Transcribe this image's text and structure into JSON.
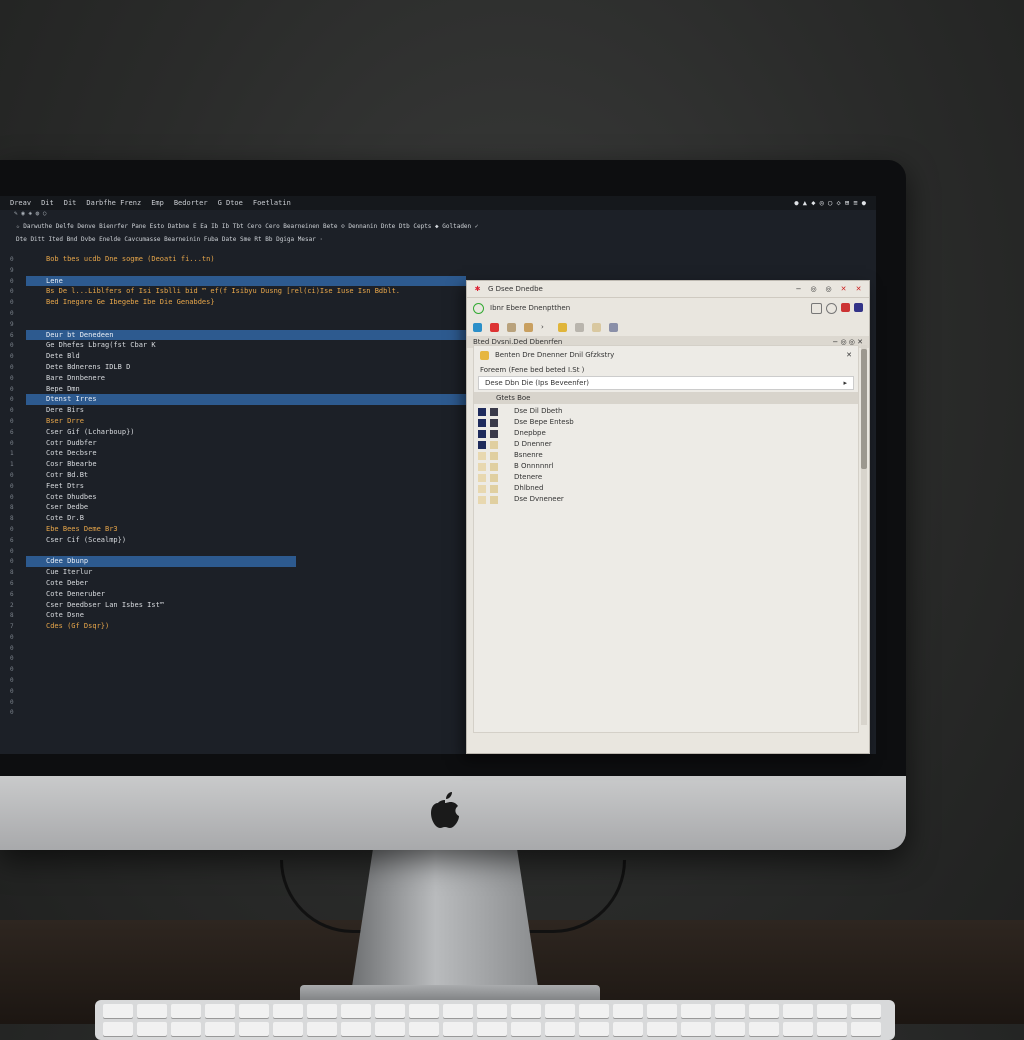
{
  "screen": {
    "menubar": {
      "items": [
        "Dreav",
        "Dit",
        "Dit",
        "Darbfhe Frenz",
        "Emp",
        "Bedorter",
        "G Dtoe",
        "Foetlatin"
      ],
      "status": "● ▲ ◆ ◎ ◯ ◇ ⊞ ≡ ●"
    },
    "toolbar_row": "✎ ◉ ◈ ◍   ○",
    "toolbar_row2": "☆ Darwuthe  Delfe  Denve  Bienrfer  Pane  Esto  Datbne  E  Ea  Ib  Ib  Tbt  Cero  Cero  Bearneinen  Bete  ⊙ Dennanin  Dnte  Dtb  Cepts  ◆ Goltaden  ✓",
    "toolbar_row3": "Dte Ditt  Ited  Bnd  Dvbe Enelde  Cavcumasse  Bearneinin  Fuba  Date Sme  Rt  Bb  Dgiga  Mesar  ·",
    "gutter": [
      "0",
      "9",
      "0",
      "0",
      "0",
      "0",
      "9",
      "6",
      "0",
      "0",
      "0",
      "0",
      "0",
      "0",
      "0",
      "0",
      "6",
      "0",
      "1",
      "1",
      "0",
      "0",
      "0",
      "8",
      "8",
      "0",
      "6",
      "0",
      "0",
      "8",
      "6",
      "6",
      "2",
      "8",
      "7",
      "0",
      "0",
      "0",
      "0",
      "0",
      "0",
      "0",
      "0"
    ],
    "editor_lines": [
      {
        "text": "Bob tbes  ucdb Dne  sogme  (Deoati fi...tn)",
        "cls": "orange"
      },
      {
        "text": "",
        "cls": ""
      },
      {
        "text": "Lene",
        "cls": "hl"
      },
      {
        "text": "Bs De l...Liblfers of Isi Isblli bid  ™  ef(f Isibyu Dusng [rel(ci)Ise  Iuse Isn  Bdblt.",
        "cls": "orange"
      },
      {
        "text": "Bed  Inegare  Ge  Ibegebe  Ibe  Die  Genabdes}",
        "cls": "orange"
      },
      {
        "text": "",
        "cls": ""
      },
      {
        "text": "",
        "cls": ""
      },
      {
        "text": "Deur bt Denedeen",
        "cls": "hl"
      },
      {
        "text": "Ge   Dhefes  Lbrag(fst  Cbar  K",
        "cls": ""
      },
      {
        "text": "Dete  Bld",
        "cls": ""
      },
      {
        "text": "Dete  Bdnerens  IDLB  D",
        "cls": ""
      },
      {
        "text": "Bare  Dnnbenere",
        "cls": ""
      },
      {
        "text": "Bepe  Dmn",
        "cls": ""
      },
      {
        "text": "Dtenst  Irres",
        "cls": "hl"
      },
      {
        "text": "Dere  Birs",
        "cls": ""
      },
      {
        "text": "Bser  Drre",
        "cls": "orange"
      },
      {
        "text": "Cser  Gif  (Lcharboup})",
        "cls": ""
      },
      {
        "text": "Cotr  Dudbfer",
        "cls": ""
      },
      {
        "text": "Cote  Decbsre",
        "cls": ""
      },
      {
        "text": "Cosr  Bbearbe",
        "cls": ""
      },
      {
        "text": "Cotr  Bd.Bt",
        "cls": ""
      },
      {
        "text": "Feet  Dtrs",
        "cls": ""
      },
      {
        "text": "Cote  Dhudbes",
        "cls": ""
      },
      {
        "text": "Cser  Dedbe",
        "cls": ""
      },
      {
        "text": "Cote  Dr.B",
        "cls": ""
      },
      {
        "text": "Ebe  Bees  Deme  Br3",
        "cls": "orange"
      },
      {
        "text": "Cser  Cif  (Scealmp})",
        "cls": ""
      },
      {
        "text": "",
        "cls": ""
      },
      {
        "text": "Cdee  Dbunp",
        "cls": "hl"
      },
      {
        "text": "Cue  Iterlur",
        "cls": ""
      },
      {
        "text": "Cote  Deber",
        "cls": ""
      },
      {
        "text": "Cote  Deneruber",
        "cls": ""
      },
      {
        "text": "Cser  Deedbser  Lan  Isbes  Ist™",
        "cls": ""
      },
      {
        "text": "Cote  Dsne",
        "cls": ""
      },
      {
        "text": "Cdes  (Gf  Dsqr})",
        "cls": "orange"
      }
    ],
    "file_window": {
      "title": "G  Dsee  Dnedbe",
      "path": "Ibnr  Ebere  Dnenptthen",
      "section": "Bted Dvsni.Ded Dbenrfen",
      "subtitle": "Benten Dre Dnenner  Dnil  Gfzkstry",
      "filter": "Foreem  (Fene  bed  beted  I.St  )",
      "search": "Dese  Dbn  Die  (Ips  Beveenfer)",
      "header": "Gtets Boe",
      "items": [
        "Dse  Dil  Dbeth",
        "Dse  Bepe  Entesb",
        "Dnepbpe",
        "D  Dnenner",
        "Bsnenre",
        "B  Onnnnnrl",
        "Dtenere",
        "Dhlbned",
        "Dse  Dvneneer"
      ]
    }
  }
}
